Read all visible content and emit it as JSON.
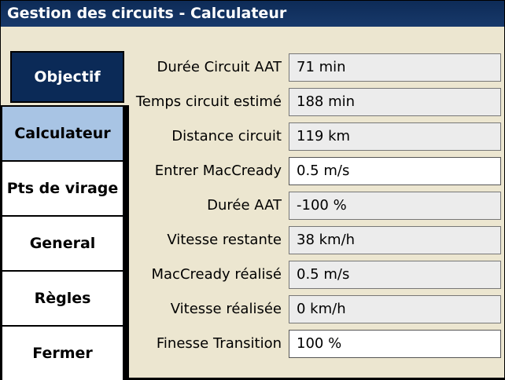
{
  "window": {
    "title": "Gestion des circuits - Calculateur"
  },
  "tabs": {
    "objectif": "Objectif",
    "calculateur": "Calculateur",
    "pts_virage": "Pts de virage",
    "general": "General",
    "regles": "Règles",
    "fermer": "Fermer"
  },
  "rows": [
    {
      "label": "Durée Circuit AAT",
      "value": "71 min"
    },
    {
      "label": "Temps circuit estimé",
      "value": "188 min"
    },
    {
      "label": "Distance circuit",
      "value": "119 km"
    },
    {
      "label": "Entrer MacCready",
      "value": "0.5 m/s"
    },
    {
      "label": "Durée AAT",
      "value": "-100 %"
    },
    {
      "label": "Vitesse restante",
      "value": "38 km/h"
    },
    {
      "label": "MacCready réalisé",
      "value": "0.5 m/s"
    },
    {
      "label": "Vitesse réalisée",
      "value": "0 km/h"
    },
    {
      "label": "Finesse Transition",
      "value": "100 %"
    }
  ]
}
